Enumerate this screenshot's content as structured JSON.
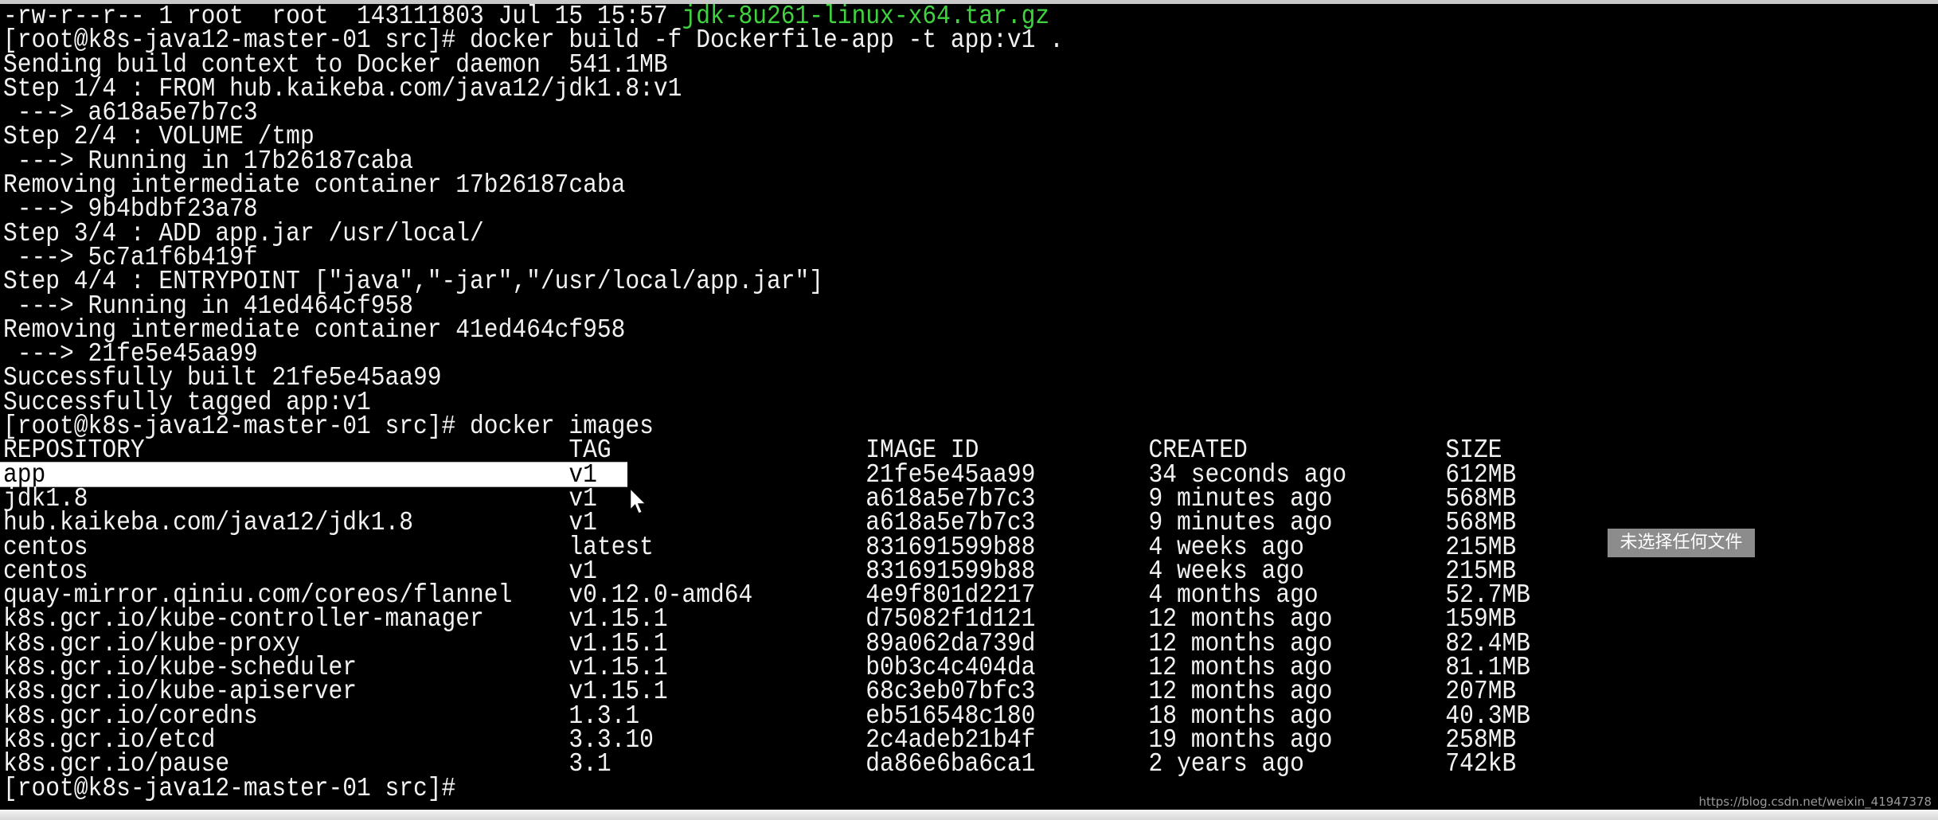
{
  "terminal": {
    "first_line_prefix": "-rw-r--r-- 1 root  root  143111803 Jul 15 15:57 ",
    "first_line_file": "jdk-8u261-linux-x64.tar.gz",
    "file_color": "#3fd43f",
    "build_lines": [
      "[root@k8s-java12-master-01 src]# docker build -f Dockerfile-app -t app:v1 .",
      "Sending build context to Docker daemon  541.1MB",
      "Step 1/4 : FROM hub.kaikeba.com/java12/jdk1.8:v1",
      " ---> a618a5e7b7c3",
      "Step 2/4 : VOLUME /tmp",
      " ---> Running in 17b26187caba",
      "Removing intermediate container 17b26187caba",
      " ---> 9b4bdbf23a78",
      "Step 3/4 : ADD app.jar /usr/local/",
      " ---> 5c7a1f6b419f",
      "Step 4/4 : ENTRYPOINT [\"java\",\"-jar\",\"/usr/local/app.jar\"]",
      " ---> Running in 41ed464cf958",
      "Removing intermediate container 41ed464cf958",
      " ---> 21fe5e45aa99",
      "Successfully built 21fe5e45aa99",
      "Successfully tagged app:v1",
      "[root@k8s-java12-master-01 src]# docker images"
    ],
    "images_table": {
      "headers": [
        "REPOSITORY",
        "TAG",
        "IMAGE ID",
        "CREATED",
        "SIZE"
      ],
      "rows": [
        [
          "app",
          "v1",
          "21fe5e45aa99",
          "34 seconds ago",
          "612MB"
        ],
        [
          "jdk1.8",
          "v1",
          "a618a5e7b7c3",
          "9 minutes ago",
          "568MB"
        ],
        [
          "hub.kaikeba.com/java12/jdk1.8",
          "v1",
          "a618a5e7b7c3",
          "9 minutes ago",
          "568MB"
        ],
        [
          "centos",
          "latest",
          "831691599b88",
          "4 weeks ago",
          "215MB"
        ],
        [
          "centos",
          "v1",
          "831691599b88",
          "4 weeks ago",
          "215MB"
        ],
        [
          "quay-mirror.qiniu.com/coreos/flannel",
          "v0.12.0-amd64",
          "4e9f801d2217",
          "4 months ago",
          "52.7MB"
        ],
        [
          "k8s.gcr.io/kube-controller-manager",
          "v1.15.1",
          "d75082f1d121",
          "12 months ago",
          "159MB"
        ],
        [
          "k8s.gcr.io/kube-proxy",
          "v1.15.1",
          "89a062da739d",
          "12 months ago",
          "82.4MB"
        ],
        [
          "k8s.gcr.io/kube-scheduler",
          "v1.15.1",
          "b0b3c4c404da",
          "12 months ago",
          "81.1MB"
        ],
        [
          "k8s.gcr.io/kube-apiserver",
          "v1.15.1",
          "68c3eb07bfc3",
          "12 months ago",
          "207MB"
        ],
        [
          "k8s.gcr.io/coredns",
          "1.3.1",
          "eb516548c180",
          "18 months ago",
          "40.3MB"
        ],
        [
          "k8s.gcr.io/etcd",
          "3.3.10",
          "2c4adeb21b4f",
          "19 months ago",
          "258MB"
        ],
        [
          "k8s.gcr.io/pause",
          "3.1",
          "da86e6ba6ca1",
          "2 years ago",
          "742kB"
        ]
      ],
      "selected_row": 0
    },
    "prompt": "[root@k8s-java12-master-01 src]#"
  },
  "tooltip": "未选择任何文件",
  "watermark": "https://blog.csdn.net/weixin_41947378"
}
